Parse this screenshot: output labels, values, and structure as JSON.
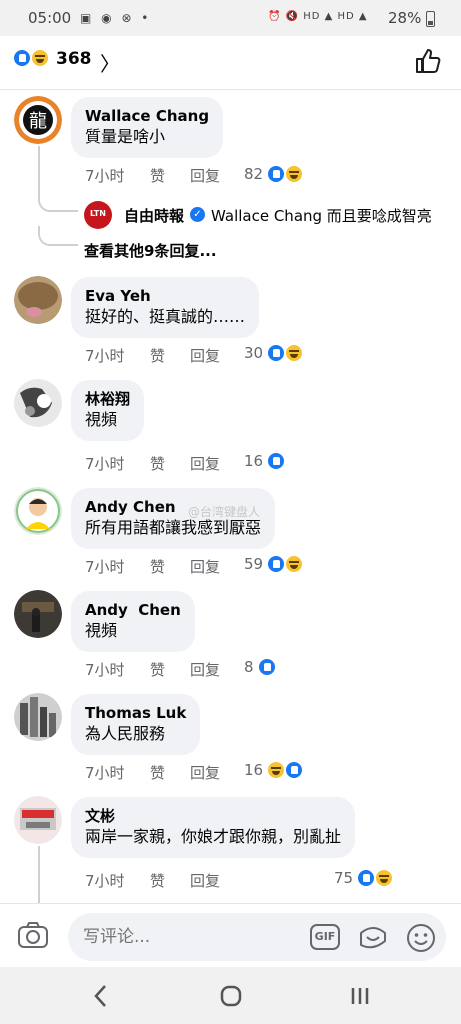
{
  "status_bar": {
    "time": "05:00",
    "left_icons": "▣ ◉ ⊗ •",
    "right_icons": "⏰ 🔇 HD ▲ HD ▲",
    "battery": "28%"
  },
  "header": {
    "reaction_count": "368",
    "reactions": [
      "like",
      "haha"
    ]
  },
  "comments": [
    {
      "name": "Wallace Chang",
      "text": "質量是啥小",
      "time": "7小时",
      "like_label": "赞",
      "reply_label": "回复",
      "reaction_count": "82",
      "reactions": [
        "like",
        "haha"
      ]
    },
    {
      "name": "Eva Yeh",
      "text": "挺好的、挺真誠的……",
      "time": "7小时",
      "like_label": "赞",
      "reply_label": "回复",
      "reaction_count": "30",
      "reactions": [
        "like",
        "haha"
      ]
    },
    {
      "name": "林裕翔",
      "text": "視頻",
      "time": "7小时",
      "like_label": "赞",
      "reply_label": "回复",
      "reaction_count": "16",
      "reactions": [
        "like"
      ]
    },
    {
      "name": "Andy Chen",
      "text": "所有用語都讓我感到厭惡",
      "time": "7小时",
      "like_label": "赞",
      "reply_label": "回复",
      "reaction_count": "59",
      "reactions": [
        "like",
        "haha"
      ]
    },
    {
      "name": "Andy  Chen",
      "text": "視頻",
      "time": "7小时",
      "like_label": "赞",
      "reply_label": "回复",
      "reaction_count": "8",
      "reactions": [
        "like"
      ]
    },
    {
      "name": "Thomas Luk",
      "text": "為人民服務",
      "time": "7小时",
      "like_label": "赞",
      "reply_label": "回复",
      "reaction_count": "16",
      "reactions": [
        "haha",
        "like"
      ]
    },
    {
      "name": "文彬",
      "text": "兩岸一家親，你娘才跟你親，別亂扯",
      "time": "7小时",
      "like_label": "赞",
      "reply_label": "回复",
      "reaction_count": "75",
      "reactions": [
        "like",
        "haha"
      ]
    }
  ],
  "reply_preview": {
    "page_badge": "LTN",
    "name": "自由時報",
    "text": "Wallace Chang 而且要唸成智亮",
    "more": "查看其他9条回复..."
  },
  "watermark": "@台湾键盘人",
  "composer": {
    "placeholder": "写评论...",
    "gif_label": "GIF"
  },
  "colors": {
    "accent": "#1877f2",
    "bubble": "#f0f2f5",
    "secondary_text": "#65676b",
    "haha": "#f7c22f"
  }
}
